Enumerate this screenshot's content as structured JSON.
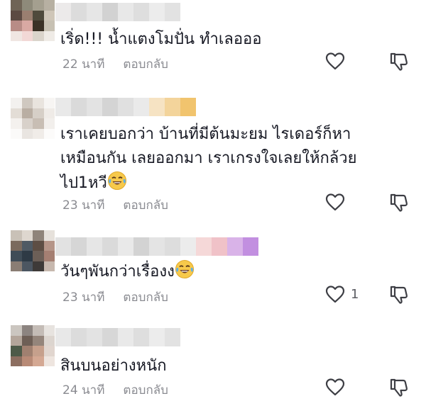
{
  "comments": [
    {
      "text": "เริ่ด!!! น้ำแตงโมปั่น ทำเลอออ",
      "time": "22 นาที",
      "reply_label": "ตอบกลับ",
      "likes": ""
    },
    {
      "text": "เราเคยบอกว่า บ้านที่มีต้นมะยม ไรเดอร์ก็หา\nเหมือนกัน เลยออกมา เราเกรงใจเลยให้กล้วย\nไป1หวี",
      "time": "23 นาที",
      "reply_label": "ตอบกลับ",
      "likes": ""
    },
    {
      "text": "วันๆพันกว่าเรื่องง",
      "time": "23 นาที",
      "reply_label": "ตอบกลับ",
      "likes": "1"
    },
    {
      "text": "สินบนอย่างหนัก",
      "time": "24 นาที",
      "reply_label": "ตอบกลับ",
      "likes": ""
    }
  ],
  "icons": {
    "like": "heart-outline-icon",
    "dislike": "thumbs-down-outline-icon",
    "emoji": "face-with-tears-of-joy-emoji"
  },
  "colors": {
    "text": "#161823",
    "meta": "#8a8b91",
    "icon": "#3d3e44"
  }
}
